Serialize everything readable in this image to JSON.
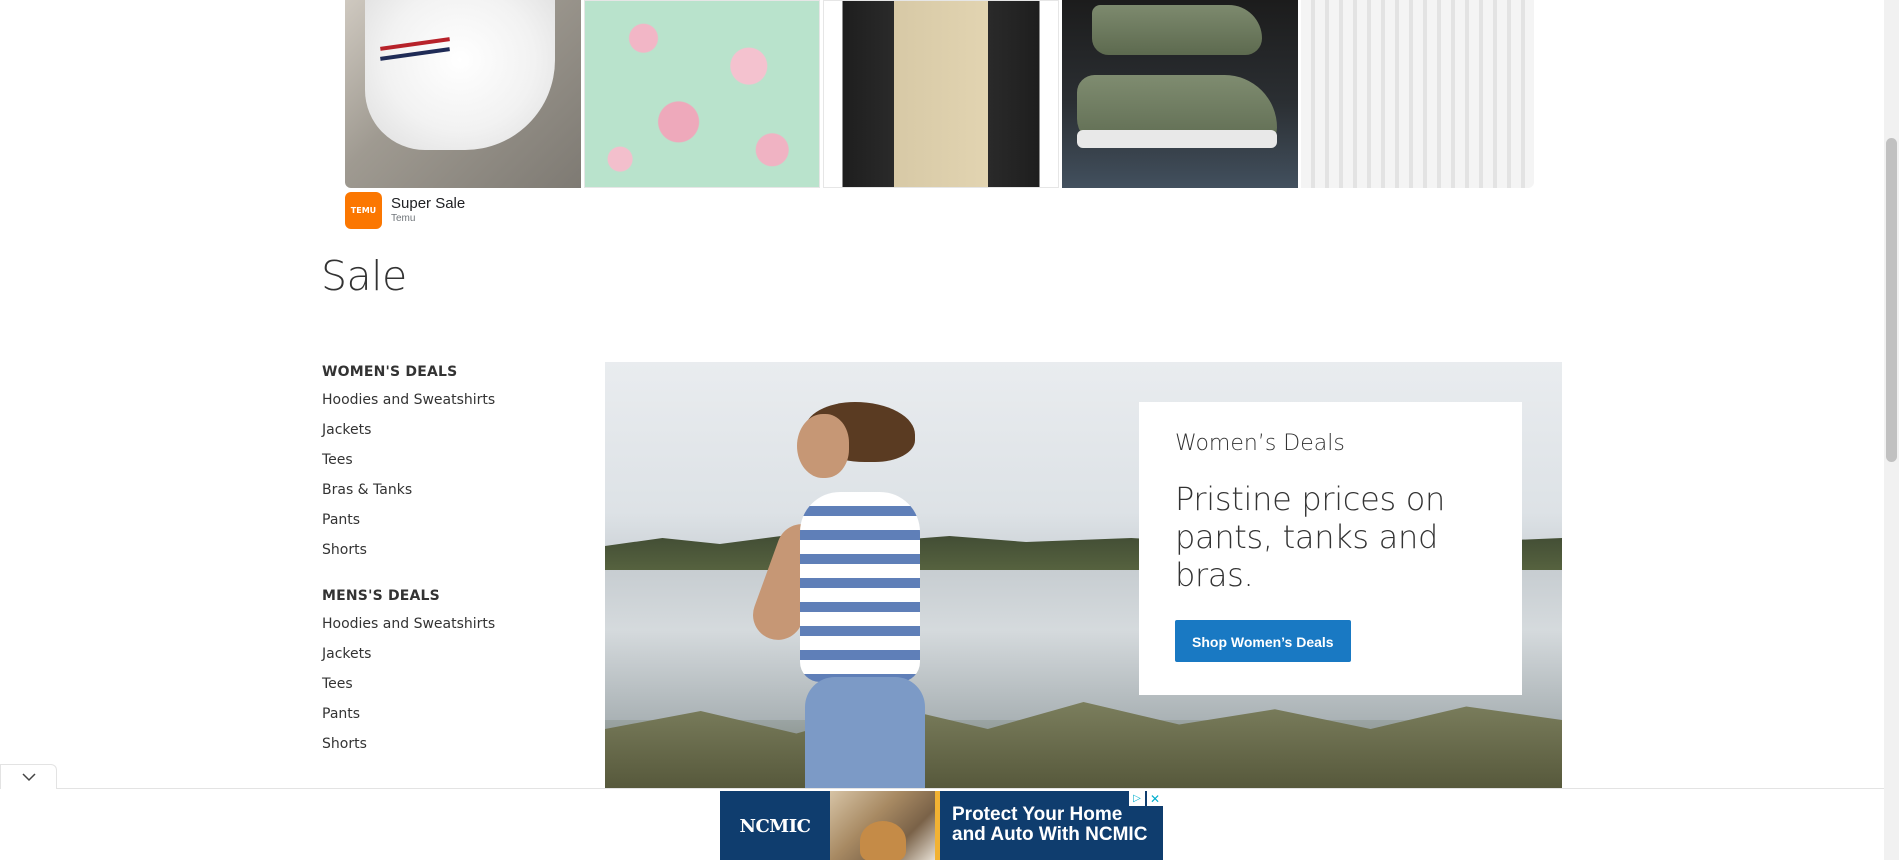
{
  "top_ad": {
    "images": [
      {
        "icon": "white-sneaker-image"
      },
      {
        "icon": "floral-pencil-case-image"
      },
      {
        "icon": "black-fleece-jacket-image"
      },
      {
        "icon": "green-sneakers-image"
      },
      {
        "icon": "white-knit-sweater-image"
      }
    ],
    "logo_text": "TEMU",
    "title": "Super Sale",
    "advertiser": "Temu"
  },
  "page": {
    "title": "Sale"
  },
  "sidebar": {
    "groups": [
      {
        "heading": "WOMEN'S DEALS",
        "items": [
          "Hoodies and Sweatshirts",
          "Jackets",
          "Tees",
          "Bras & Tanks",
          "Pants",
          "Shorts"
        ]
      },
      {
        "heading": "MENS'S DEALS",
        "items": [
          "Hoodies and Sweatshirts",
          "Jackets",
          "Tees",
          "Pants",
          "Shorts"
        ]
      }
    ]
  },
  "hero": {
    "eyebrow": "Women’s Deals",
    "headline": "Pristine prices on pants, tanks and bras.",
    "button_label": "Shop Women’s Deals",
    "button_color": "#1979c3"
  },
  "bottom_ad": {
    "logo": "NCMIC",
    "headline": "Protect Your Home and Auto With NCMIC",
    "collapse_icon": "chevron-down-icon",
    "adchoices_icon": "adchoices-icon",
    "close_icon": "close-icon"
  }
}
